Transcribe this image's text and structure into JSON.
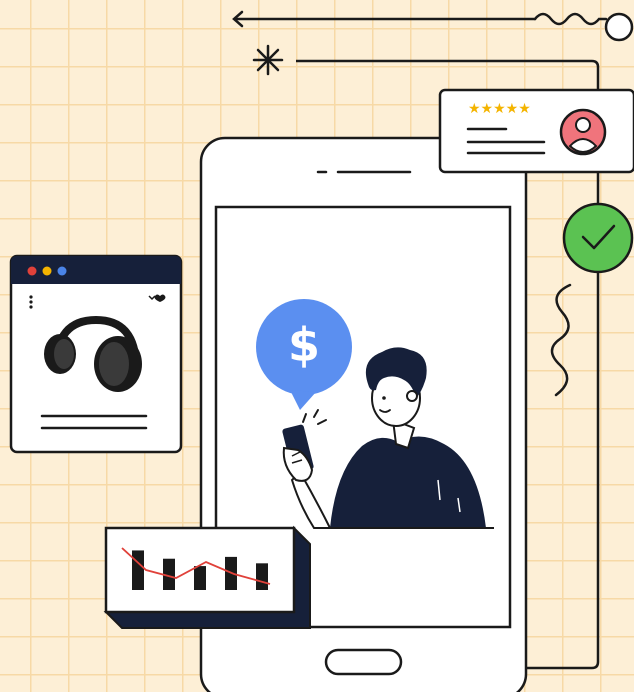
{
  "review_card": {
    "stars": "★★★★★",
    "star_color": "#F4B400",
    "avatar_color": "#F0747C"
  },
  "payment_bubble": {
    "symbol": "$",
    "color": "#5B8FF0"
  },
  "product_window": {
    "dot_colors": [
      "#E0413A",
      "#F4B400",
      "#4A84E8"
    ],
    "icons": [
      "kebab-menu-icon",
      "heart-icon",
      "headphones-icon"
    ]
  },
  "status": {
    "check_color": "#5BC252",
    "icon": "check-icon"
  },
  "bar_chart": {
    "trend_color": "#E0413A",
    "bar_levels": [
      0.86,
      0.68,
      0.52,
      0.72,
      0.58
    ]
  },
  "colors": {
    "background": "#FDEFD6",
    "grid": "#F7D9A6",
    "ink": "#16203A",
    "outline": "#1A1A1A"
  }
}
